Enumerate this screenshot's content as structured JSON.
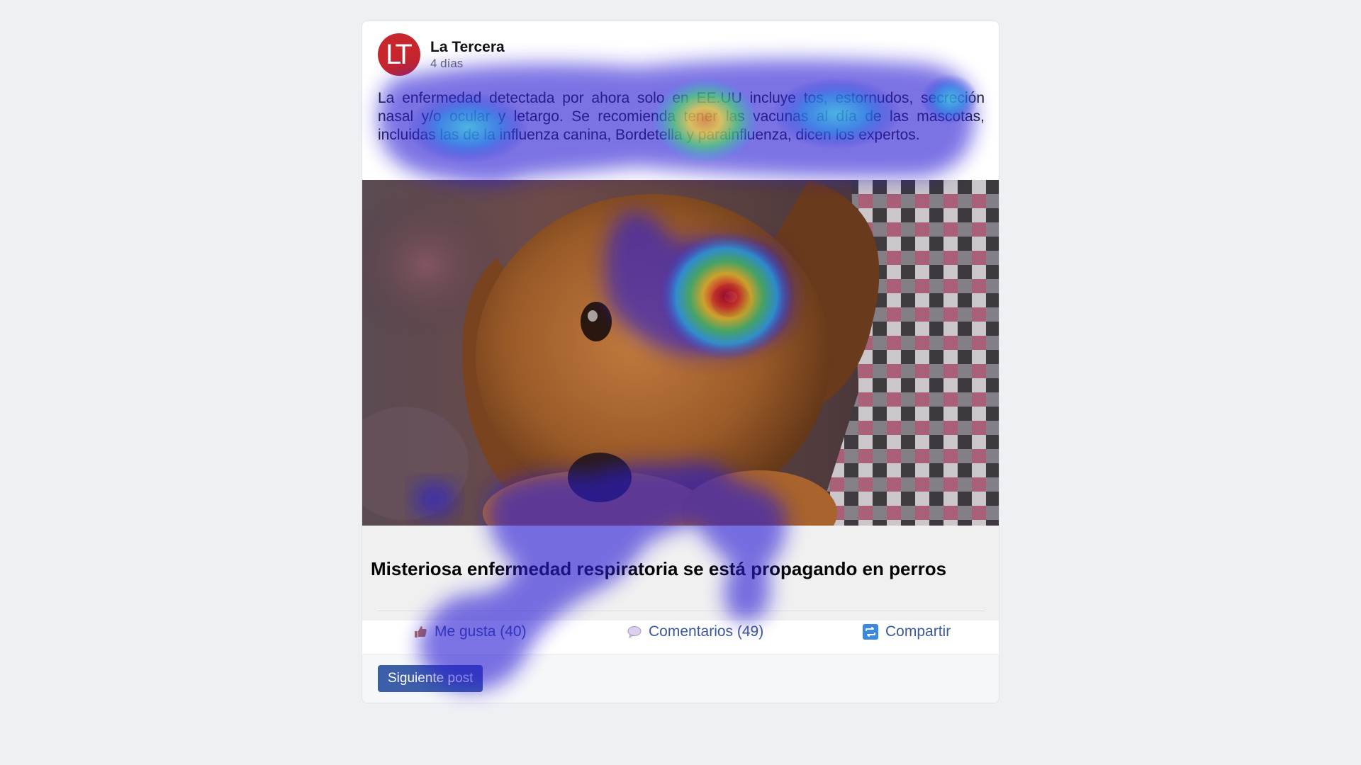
{
  "post": {
    "page_name": "La Tercera",
    "logo_text": "LT",
    "time": "4 días",
    "text": "La enfermedad detectada por ahora solo en EE.UU incluye tos, estornudos, secreción nasal y/o ocular y letargo. Se recomienda tener las vacunas al día de las mascotas, incluidas las de la influenza canina, Bordetella y parainfluenza, dicen los expertos.",
    "link_title": "Misteriosa enfermedad respiratoria se está propagando en perros",
    "image_icon": "dog-photo"
  },
  "actions": {
    "like_label": "Me gusta (40)",
    "like_icon": "thumbs-up-icon",
    "comment_label": "Comentarios (49)",
    "comment_icon": "speech-bubble-icon",
    "share_label": "Compartir",
    "share_icon": "share-icon"
  },
  "footer": {
    "next_label": "Siguiente post"
  },
  "colors": {
    "brand": "#c7262d",
    "link": "#3b5998",
    "button": "#3d5fa9",
    "background": "#eff0f4"
  }
}
